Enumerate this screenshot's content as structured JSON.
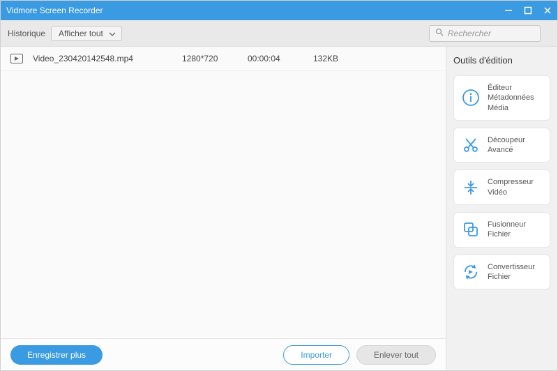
{
  "titlebar": {
    "title": "Vidmore Screen Recorder"
  },
  "toolbar": {
    "history_label": "Historique",
    "filter_label": "Afficher tout",
    "search_placeholder": "Rechercher"
  },
  "files": [
    {
      "name": "Video_230420142548.mp4",
      "resolution": "1280*720",
      "duration": "00:00:04",
      "size": "132KB"
    }
  ],
  "footer": {
    "save_more_label": "Enregistrer plus",
    "import_label": "Importer",
    "remove_all_label": "Enlever tout"
  },
  "tools": {
    "panel_title": "Outils d'édition",
    "items": [
      {
        "icon": "info",
        "label": "Éditeur\nMétadonnées\nMédia"
      },
      {
        "icon": "scissors",
        "label": "Découpeur Avancé"
      },
      {
        "icon": "compress",
        "label": "Compresseur\nVidéo"
      },
      {
        "icon": "merge",
        "label": "Fusionneur Fichier"
      },
      {
        "icon": "convert",
        "label": "Convertisseur\nFichier"
      }
    ]
  }
}
